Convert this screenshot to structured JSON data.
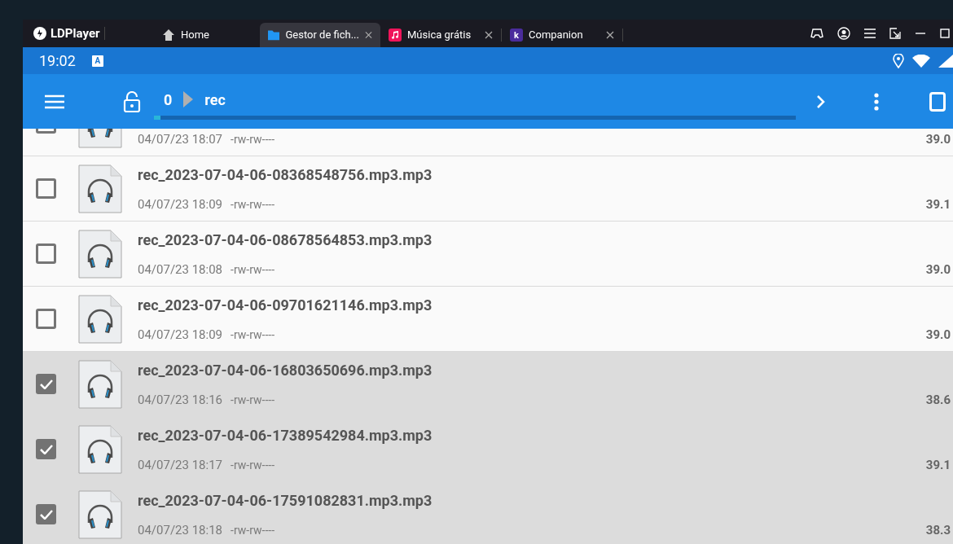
{
  "titlebar": {
    "brand": "LDPlayer",
    "tabs": [
      {
        "label": "Home",
        "kind": "home",
        "selected": false,
        "closable": false
      },
      {
        "label": "Gestor de fich...",
        "kind": "folder",
        "selected": true,
        "closable": true
      },
      {
        "label": "Música grátis",
        "kind": "music",
        "selected": false,
        "closable": true
      },
      {
        "label": "Companion",
        "kind": "companion",
        "icon_text": "k",
        "selected": false,
        "closable": true
      }
    ]
  },
  "status_bar": {
    "time": "19:02",
    "badge": "A"
  },
  "toolbar": {
    "path": [
      "0",
      "rec"
    ],
    "progress": {
      "level": 0.01
    }
  },
  "files": [
    {
      "date": "04/07/23 18:07",
      "perms": "-rw-rw----",
      "size": "39.0",
      "selected": false
    },
    {
      "name": "rec_2023-07-04-06-08368548756.mp3.mp3",
      "date": "04/07/23 18:09",
      "perms": "-rw-rw----",
      "size": "39.1",
      "selected": false
    },
    {
      "name": "rec_2023-07-04-06-08678564853.mp3.mp3",
      "date": "04/07/23 18:08",
      "perms": "-rw-rw----",
      "size": "39.0",
      "selected": false
    },
    {
      "name": "rec_2023-07-04-06-09701621146.mp3.mp3",
      "date": "04/07/23 18:09",
      "perms": "-rw-rw----",
      "size": "39.0",
      "selected": false
    },
    {
      "name": "rec_2023-07-04-06-16803650696.mp3.mp3",
      "date": "04/07/23 18:16",
      "perms": "-rw-rw----",
      "size": "38.6",
      "selected": true
    },
    {
      "name": "rec_2023-07-04-06-17389542984.mp3.mp3",
      "date": "04/07/23 18:17",
      "perms": "-rw-rw----",
      "size": "39.1",
      "selected": true
    },
    {
      "name": "rec_2023-07-04-06-17591082831.mp3.mp3",
      "date": "04/07/23 18:18",
      "perms": "-rw-rw----",
      "size": "38.3",
      "selected": true
    }
  ]
}
